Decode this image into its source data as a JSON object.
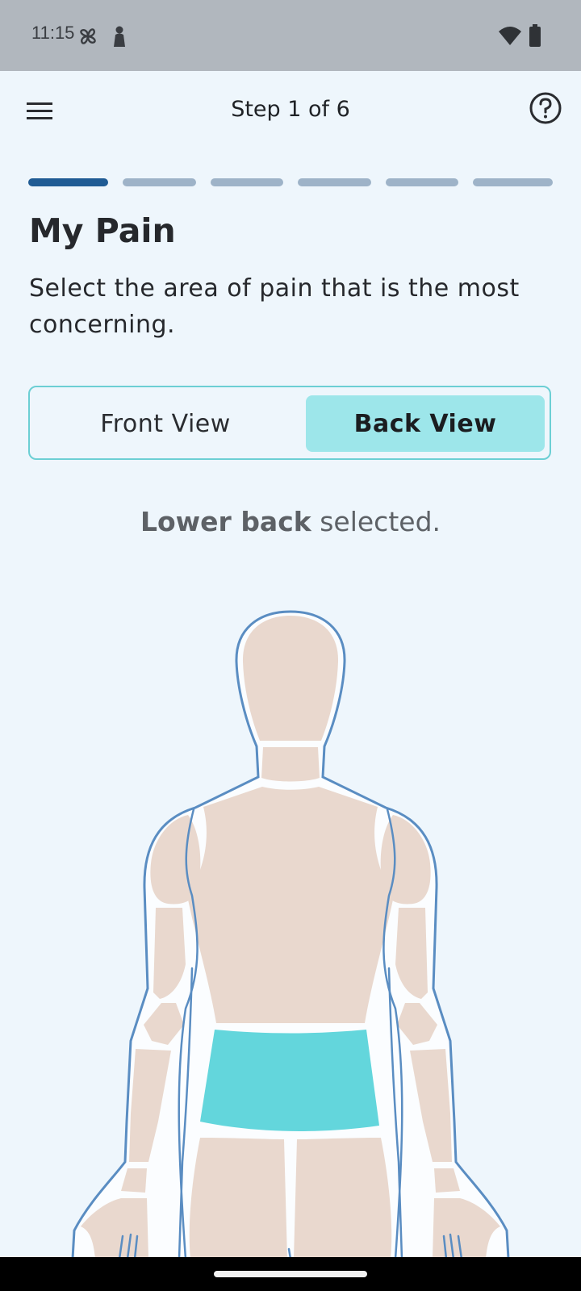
{
  "status_bar": {
    "time": "11:15",
    "icons": [
      "fan-icon",
      "person-silhouette-icon",
      "wifi-icon",
      "battery-icon"
    ]
  },
  "app_bar": {
    "menu_icon": "menu-icon",
    "step_label": "Step 1 of 6",
    "help_icon": "help-circle-icon"
  },
  "progress": {
    "current_step": 1,
    "total_steps": 6
  },
  "page": {
    "title": "My Pain",
    "instructions": "Select the area of pain that is the most concerning."
  },
  "view_toggle": {
    "options": [
      "Front View",
      "Back View"
    ],
    "selected": "Back View"
  },
  "selection_text": {
    "region": "Lower back",
    "suffix": "selected."
  },
  "body_map": {
    "view": "back",
    "selected_region": "Lower back"
  },
  "colors": {
    "background": "#eef6fc",
    "accent_selected": "#63d6dc",
    "toggle_active": "#9de6ea",
    "progress_active": "#1f5b94",
    "progress_inactive": "#9eb3c8",
    "body_fill": "#e9d8ce",
    "body_outline": "#5a8dc2"
  }
}
